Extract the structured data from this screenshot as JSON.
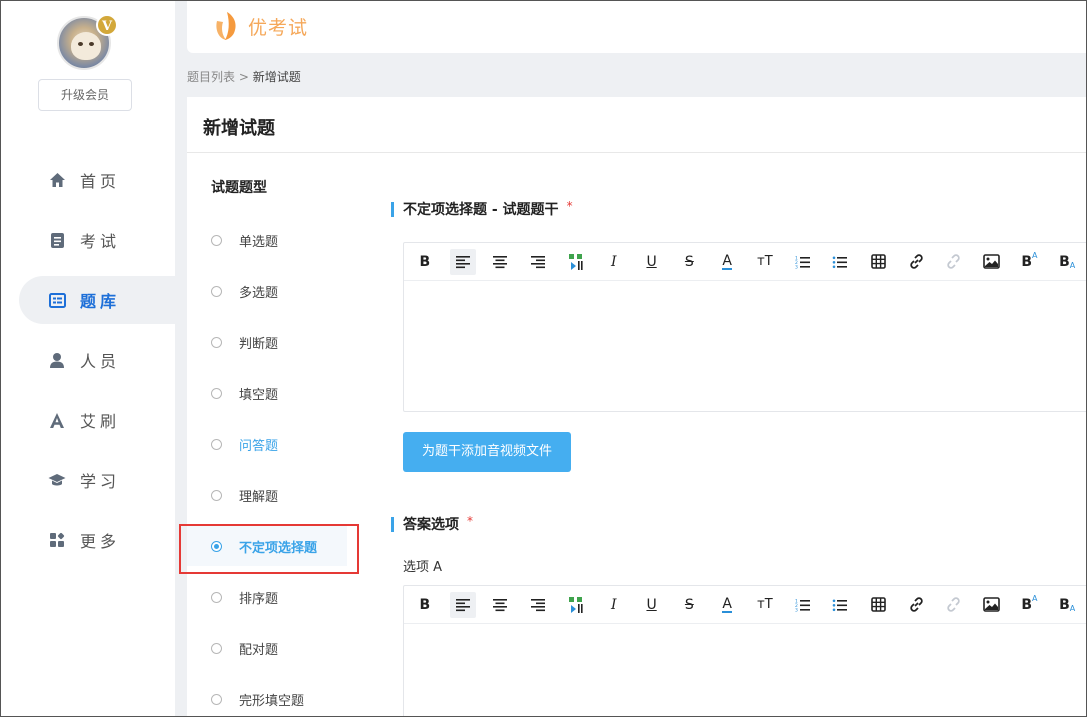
{
  "sidebar": {
    "vip_badge": "V",
    "upgrade_label": "升级会员",
    "items": [
      {
        "label": "首页",
        "icon": "home-icon"
      },
      {
        "label": "考试",
        "icon": "exam-icon"
      },
      {
        "label": "题库",
        "icon": "question-bank-icon",
        "active": true
      },
      {
        "label": "人员",
        "icon": "user-icon"
      },
      {
        "label": "艾刷",
        "icon": "a-letter-icon"
      },
      {
        "label": "学习",
        "icon": "graduation-cap-icon"
      },
      {
        "label": "更多",
        "icon": "more-grid-icon"
      }
    ]
  },
  "header": {
    "logo_text": "优考试"
  },
  "breadcrumb": {
    "parent": "题目列表",
    "separator": " > ",
    "current": "新增试题"
  },
  "page": {
    "title": "新增试题",
    "types_title": "试题题型",
    "types": [
      {
        "label": "单选题"
      },
      {
        "label": "多选题"
      },
      {
        "label": "判断题"
      },
      {
        "label": "填空题"
      },
      {
        "label": "问答题",
        "state": "hover"
      },
      {
        "label": "理解题"
      },
      {
        "label": "不定项选择题",
        "state": "selected"
      },
      {
        "label": "排序题"
      },
      {
        "label": "配对题"
      },
      {
        "label": "完形填空题"
      }
    ],
    "stem_section": {
      "title": "不定项选择题 - 试题题干",
      "required_mark": "*"
    },
    "media_button": "为题干添加音视频文件",
    "options_section": {
      "title": "答案选项",
      "required_mark": "*"
    },
    "option_a_label": "选项 A"
  },
  "toolbar_buttons": [
    {
      "name": "bold",
      "glyph": "B"
    },
    {
      "name": "align-left",
      "active": true
    },
    {
      "name": "align-center"
    },
    {
      "name": "align-right"
    },
    {
      "name": "image-text"
    },
    {
      "name": "italic",
      "glyph": "I"
    },
    {
      "name": "underline",
      "glyph": "U"
    },
    {
      "name": "strikethrough",
      "glyph": "S"
    },
    {
      "name": "font-color",
      "glyph": "A"
    },
    {
      "name": "font-size",
      "glyph": "тT"
    },
    {
      "name": "ordered-list"
    },
    {
      "name": "unordered-list"
    },
    {
      "name": "table"
    },
    {
      "name": "link"
    },
    {
      "name": "unlink"
    },
    {
      "name": "insert-image"
    },
    {
      "name": "superscript",
      "glyph": "B"
    },
    {
      "name": "subscript",
      "glyph": "B"
    }
  ],
  "colors": {
    "accent": "#3aa3e8",
    "nav_active": "#1d6fd8",
    "required": "#e53935",
    "button": "#45aef0",
    "logo": "#f5a85a"
  }
}
